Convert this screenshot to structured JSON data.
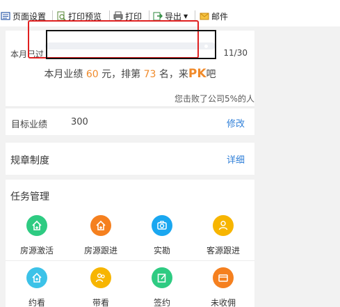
{
  "toolbar": {
    "page_setup": "页面设置",
    "print_preview": "打印预览",
    "print": "打印",
    "export": "导出",
    "mail": "邮件"
  },
  "progress": {
    "label": "本月已过",
    "value": "11/30",
    "fraction": 0.3667
  },
  "performance": {
    "prefix": "本月业绩",
    "amount": "60",
    "unit": "元，排第",
    "rank": "73",
    "suffix": "名，来",
    "pk": "PK",
    "end": "吧",
    "beat_text": "您击败了公司5%的人"
  },
  "target": {
    "label": "目标业绩",
    "value": "300",
    "edit": "修改"
  },
  "rules": {
    "label": "规章制度",
    "detail": "详细"
  },
  "tasks": {
    "title": "任务管理",
    "items": [
      {
        "label": "房源激活",
        "icon": "house-plus-icon",
        "color": "#2ecb82"
      },
      {
        "label": "房源跟进",
        "icon": "house-plus-icon",
        "color": "#f5801f"
      },
      {
        "label": "实勘",
        "icon": "camera-icon",
        "color": "#1aa7f0"
      },
      {
        "label": "客源跟进",
        "icon": "person-icon",
        "color": "#f7b500"
      },
      {
        "label": "约看",
        "icon": "house-icon",
        "color": "#3cc2e8"
      },
      {
        "label": "带看",
        "icon": "people-icon",
        "color": "#f7b500"
      },
      {
        "label": "签约",
        "icon": "edit-icon",
        "color": "#2ecb82"
      },
      {
        "label": "未收佣",
        "icon": "card-icon",
        "color": "#f5801f"
      }
    ]
  }
}
